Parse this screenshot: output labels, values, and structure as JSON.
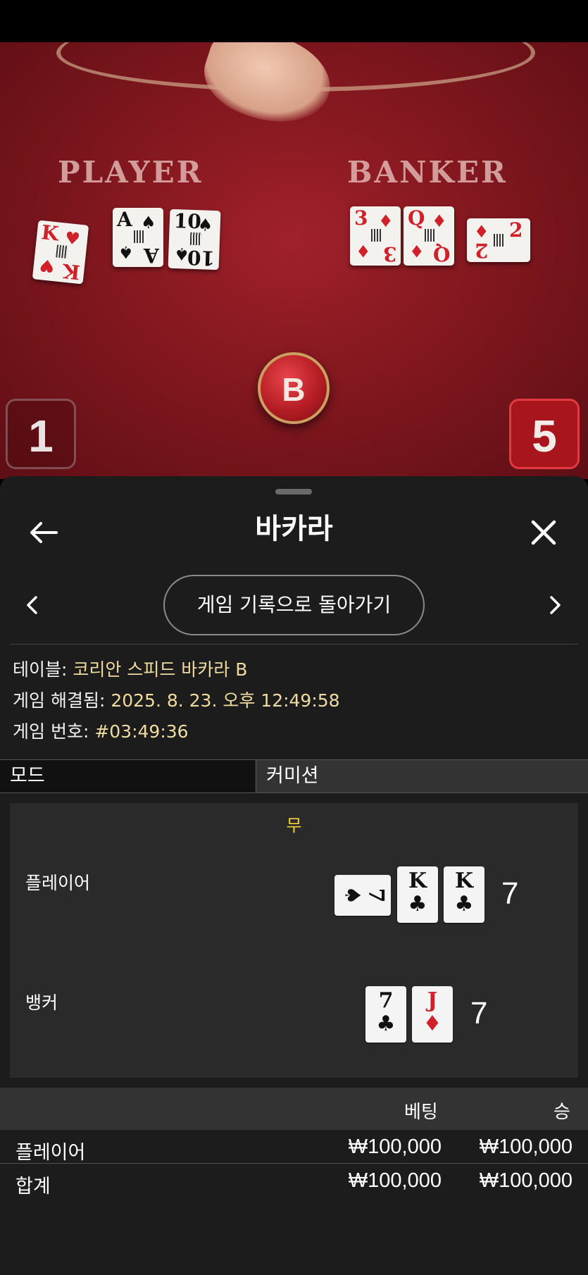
{
  "table_view": {
    "player_label": "PLAYER",
    "banker_label": "BANKER",
    "player_cards": [
      {
        "rank": "K",
        "suit": "♥",
        "color": "red"
      },
      {
        "rank": "A",
        "suit": "♠",
        "color": "black"
      },
      {
        "rank": "10",
        "suit": "♠",
        "color": "black"
      }
    ],
    "banker_cards": [
      {
        "rank": "3",
        "suit": "♦",
        "color": "red"
      },
      {
        "rank": "Q",
        "suit": "♦",
        "color": "red"
      },
      {
        "rank": "2",
        "suit": "♦",
        "color": "red"
      }
    ],
    "token_label": "B",
    "left_score": "1",
    "right_score": "5"
  },
  "sheet": {
    "title": "바카라",
    "back_to_history": "게임 기록으로 돌아가기",
    "info": {
      "table_key": "테이블: ",
      "table_value": "코리안 스피드 바카라 B",
      "resolved_key": "게임 해결됨: ",
      "resolved_value": "2025. 8. 23. 오후 12:49:58",
      "game_no_key": "게임 번호: ",
      "game_no_value": "#03:49:36"
    },
    "tabs": {
      "mode": "모드",
      "commission": "커미션"
    },
    "result": {
      "outcome": "무",
      "player_label": "플레이어",
      "player_total": "7",
      "player_cards": [
        {
          "rank": "7",
          "suit": "♠",
          "color": "black",
          "sideways": true
        },
        {
          "rank": "K",
          "suit": "♣",
          "color": "black"
        },
        {
          "rank": "K",
          "suit": "♣",
          "color": "black"
        }
      ],
      "banker_label": "뱅커",
      "banker_total": "7",
      "banker_cards": [
        {
          "rank": "7",
          "suit": "♣",
          "color": "black"
        },
        {
          "rank": "J",
          "suit": "♦",
          "color": "red"
        }
      ]
    },
    "bets": {
      "col_bet": "베팅",
      "col_win": "승",
      "rows": [
        {
          "label": "플레이어",
          "bet": "₩100,000",
          "win": "₩100,000"
        },
        {
          "label": "합계",
          "bet": "₩100,000",
          "win": "₩100,000"
        }
      ]
    },
    "colors": {
      "accent_info": "#f0dca0",
      "outcome": "#f5d23a",
      "card_red": "#d0202a"
    }
  }
}
